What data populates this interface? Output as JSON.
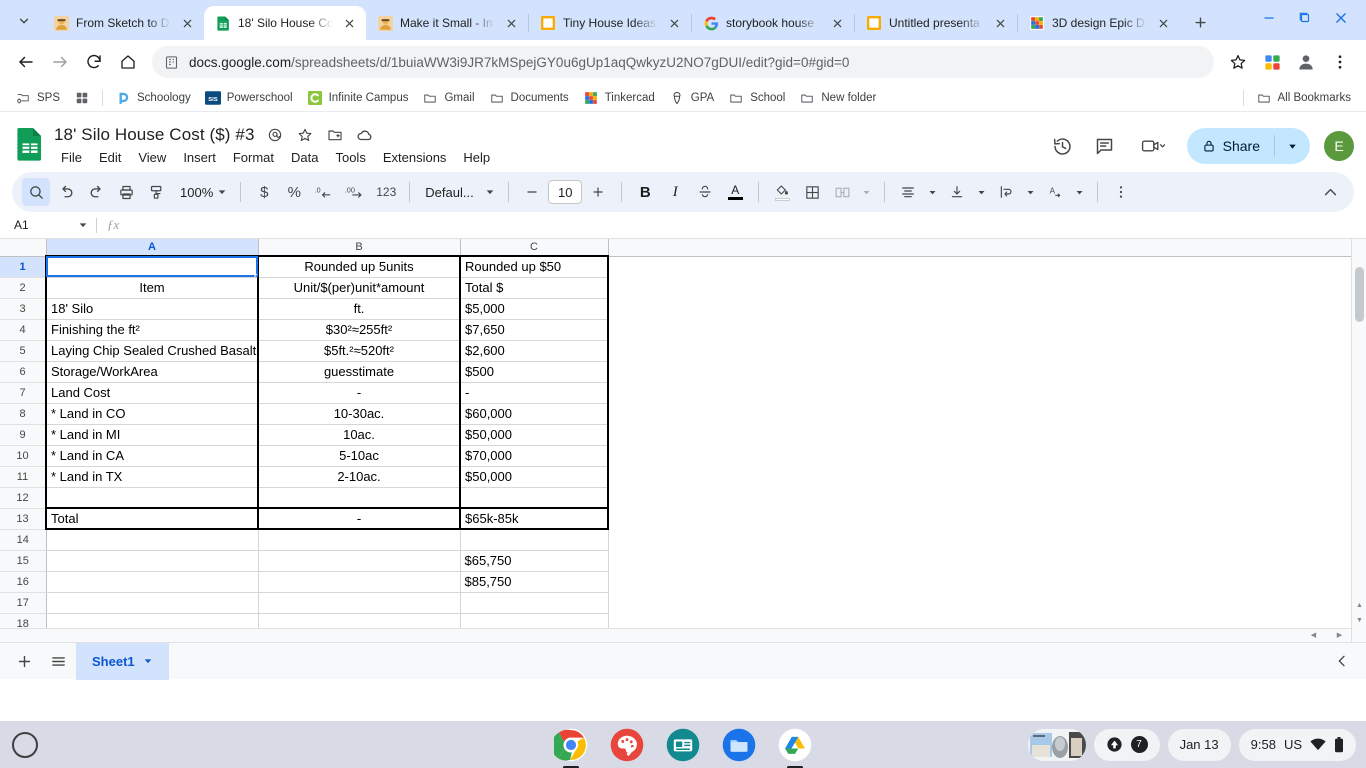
{
  "browser": {
    "tabs": [
      {
        "title": "From Sketch to D",
        "favicon": "person-photo-icon",
        "active": false
      },
      {
        "title": "18' Silo House Co",
        "favicon": "google-sheets-icon",
        "active": true
      },
      {
        "title": "Make it Small - In",
        "favicon": "person-photo-icon",
        "active": false
      },
      {
        "title": "Tiny House Ideas",
        "favicon": "orange-square-icon",
        "active": false
      },
      {
        "title": "storybook house",
        "favicon": "google-icon",
        "active": false
      },
      {
        "title": "Untitled presenta",
        "favicon": "orange-square-icon",
        "active": false
      },
      {
        "title": "3D design Epic D",
        "favicon": "tinkercad-icon",
        "active": false
      }
    ],
    "new_tab_label": "+",
    "url_bold": "docs.google.com",
    "url_rest": "/spreadsheets/d/1buiaWW3i9JR7kMSpejGY0u6gUp1aqQwkyzU2NO7gDUI/edit?gid=0#gid=0",
    "bookmarks": [
      {
        "label": "SPS",
        "icon": "folder-gear-icon"
      },
      {
        "label": "",
        "icon": "apps-grid-icon"
      },
      {
        "label": "Schoology",
        "icon": "schoology-icon"
      },
      {
        "label": "Powerschool",
        "icon": "powerschool-sis-icon"
      },
      {
        "label": "Infinite Campus",
        "icon": "infinite-campus-icon"
      },
      {
        "label": "Gmail",
        "icon": "folder-icon"
      },
      {
        "label": "Documents",
        "icon": "folder-icon"
      },
      {
        "label": "Tinkercad",
        "icon": "tinkercad-icon"
      },
      {
        "label": "GPA",
        "icon": "acorn-icon"
      },
      {
        "label": "School",
        "icon": "folder-icon"
      },
      {
        "label": "New folder",
        "icon": "folder-icon"
      }
    ],
    "all_bookmarks_label": "All Bookmarks"
  },
  "sheets": {
    "doc_title": "18' Silo House Cost ($) #3",
    "menus": [
      "File",
      "Edit",
      "View",
      "Insert",
      "Format",
      "Data",
      "Tools",
      "Extensions",
      "Help"
    ],
    "share_label": "Share",
    "avatar_initial": "E",
    "toolbar": {
      "zoom": "100%",
      "font": "Defaul...",
      "font_size": "10",
      "bold": "B",
      "italic": "I",
      "strikethrough": "S",
      "text_color": "A",
      "number_123": "123",
      "currency": "$",
      "percent": "%",
      "dec_less": ".0",
      "dec_more": ".00"
    },
    "name_box": "A1",
    "formula_value": "",
    "sheet_tab": "Sheet1"
  },
  "grid": {
    "columns": [
      "A",
      "B",
      "C"
    ],
    "selected_cell": "A1",
    "rows": [
      {
        "n": "1",
        "a": "",
        "b": "Rounded up 5units",
        "c": "Rounded up $50"
      },
      {
        "n": "2",
        "a": "Item",
        "b": "Unit/$(per)unit*amount",
        "c": "Total $"
      },
      {
        "n": "3",
        "a": "18' Silo",
        "b": "ft.",
        "c": "$5,000"
      },
      {
        "n": "4",
        "a": "Finishing the ft²",
        "b": "$30²≈255ft²",
        "c": "$7,650"
      },
      {
        "n": "5",
        "a": "Laying Chip Sealed Crushed Basalt",
        "b": "$5ft.²≈520ft²",
        "c": "$2,600"
      },
      {
        "n": "6",
        "a": "Storage/WorkArea",
        "b": "guesstimate",
        "c": "$500"
      },
      {
        "n": "7",
        "a": "Land Cost",
        "b": "-",
        "c": "-"
      },
      {
        "n": "8",
        "a": "* Land in CO",
        "b": "10-30ac.",
        "c": "$60,000"
      },
      {
        "n": "9",
        "a": "* Land in MI",
        "b": "10ac.",
        "c": "$50,000"
      },
      {
        "n": "10",
        "a": "* Land in CA",
        "b": "5-10ac",
        "c": "$70,000"
      },
      {
        "n": "11",
        "a": "* Land in TX",
        "b": "2-10ac.",
        "c": "$50,000"
      },
      {
        "n": "12",
        "a": "",
        "b": "",
        "c": ""
      },
      {
        "n": "13",
        "a": "Total",
        "b": "-",
        "c": "$65k-85k"
      },
      {
        "n": "14",
        "a": "",
        "b": "",
        "c": ""
      },
      {
        "n": "15",
        "a": "",
        "b": "",
        "c": "$65,750"
      },
      {
        "n": "16",
        "a": "",
        "b": "",
        "c": "$85,750"
      },
      {
        "n": "17",
        "a": "",
        "b": "",
        "c": ""
      },
      {
        "n": "18",
        "a": "",
        "b": "",
        "c": ""
      }
    ]
  },
  "shelf": {
    "apps": [
      "chrome-icon",
      "canvas-paint-icon",
      "news-icon",
      "files-icon",
      "google-drive-icon"
    ],
    "notification_count": "7",
    "date": "Jan 13",
    "time": "9:58",
    "locale": "US"
  }
}
